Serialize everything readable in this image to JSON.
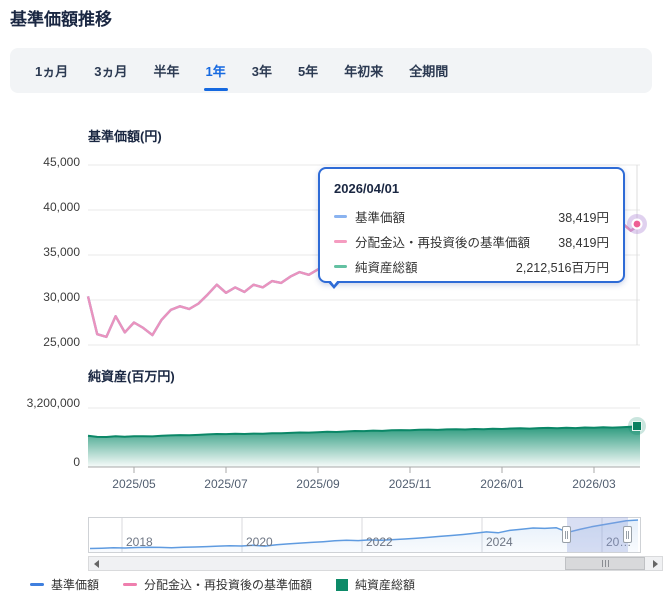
{
  "header": {
    "title": "基準価額推移"
  },
  "tabs": {
    "items": [
      {
        "label": "1ヵ月",
        "active": false
      },
      {
        "label": "3ヵ月",
        "active": false
      },
      {
        "label": "半年",
        "active": false
      },
      {
        "label": "1年",
        "active": true
      },
      {
        "label": "3年",
        "active": false
      },
      {
        "label": "5年",
        "active": false
      },
      {
        "label": "年初来",
        "active": false
      },
      {
        "label": "全期間",
        "active": false
      }
    ]
  },
  "tooltip": {
    "date": "2026/04/01",
    "rows": [
      {
        "label": "基準価額",
        "value": "38,419円",
        "color": "#8ab3f0"
      },
      {
        "label": "分配金込・再投資後の基準価額",
        "value": "38,419円",
        "color": "#f59cc0"
      },
      {
        "label": "純資産総額",
        "value": "2,212,516百万円",
        "color": "#63c1a2"
      }
    ]
  },
  "legend": {
    "items": [
      {
        "label": "基準価額",
        "color": "#3f7fde",
        "shape": "dash"
      },
      {
        "label": "分配金込・再投資後の基準価額",
        "color": "#ef7fae",
        "shape": "dash"
      },
      {
        "label": "純資産総額",
        "color": "#0d8a68",
        "shape": "square"
      }
    ]
  },
  "colors": {
    "accent_blue": "#1669e0",
    "price_line_pink": "#ea93bd",
    "price_line_blue": "#6d9eec",
    "asset_green": "#0b8767",
    "tooltip_border": "#2e6bd6",
    "navigator_line": "#5f9be0"
  },
  "chart_data": [
    {
      "type": "line",
      "title": "基準価額(円)",
      "ylim": [
        25000,
        45000
      ],
      "yticks": {
        "values": [
          45000,
          40000,
          35000,
          30000,
          25000
        ],
        "labels": [
          "45,000",
          "40,000",
          "35,000",
          "30,000",
          "25,000"
        ]
      },
      "x_range": [
        "2025/04/01",
        "2026/04/01"
      ],
      "grid": true,
      "legend_position": "bottom",
      "series": [
        {
          "name": "基準価額",
          "color": "#6d9eec",
          "values": [
            30400,
            26200,
            25900,
            28200,
            26400,
            27500,
            26900,
            26100,
            27800,
            28900,
            29300,
            29000,
            29600,
            30600,
            31700,
            30800,
            31400,
            30900,
            31700,
            31400,
            32100,
            31900,
            32600,
            33100,
            32800,
            33400,
            34000,
            33600,
            34400,
            35100,
            34800,
            35400,
            35100,
            35800,
            36100,
            35700,
            36300,
            36600,
            36200,
            36800,
            37000,
            36600,
            37200,
            36900,
            37400,
            37100,
            37700,
            38000,
            37500,
            38100,
            38300,
            37800,
            38400,
            38000,
            38600,
            38200,
            38700,
            38300,
            38600,
            37700,
            38419
          ]
        },
        {
          "name": "分配金込・再投資後の基準価額",
          "color": "#ea93bd",
          "values": [
            30400,
            26200,
            25900,
            28200,
            26400,
            27500,
            26900,
            26100,
            27800,
            28900,
            29300,
            29000,
            29600,
            30600,
            31700,
            30800,
            31400,
            30900,
            31700,
            31400,
            32100,
            31900,
            32600,
            33100,
            32800,
            33400,
            34000,
            33600,
            34400,
            35100,
            34800,
            35400,
            35100,
            35800,
            36100,
            35700,
            36300,
            36600,
            36200,
            36800,
            37000,
            36600,
            37200,
            36900,
            37400,
            37100,
            37700,
            38000,
            37500,
            38100,
            38300,
            37800,
            38400,
            38000,
            38600,
            38200,
            38700,
            38300,
            38600,
            37700,
            38419
          ]
        }
      ],
      "last_point": {
        "date": "2026/04/01",
        "value": 38419
      }
    },
    {
      "type": "area",
      "title": "純資産(百万円)",
      "ylim": [
        0,
        3200000
      ],
      "yticks": {
        "values": [
          3200000,
          0
        ],
        "labels": [
          "3,200,000",
          "0"
        ]
      },
      "xticks": {
        "labels": [
          "2025/05",
          "2025/07",
          "2025/09",
          "2025/11",
          "2026/01",
          "2026/03"
        ]
      },
      "grid": true,
      "series": [
        {
          "name": "純資産総額",
          "color": "#0b8767",
          "values": [
            1690000,
            1630000,
            1625000,
            1665000,
            1645000,
            1672000,
            1668000,
            1662000,
            1690000,
            1712000,
            1730000,
            1726000,
            1742000,
            1768000,
            1790000,
            1782000,
            1800000,
            1792000,
            1812000,
            1808000,
            1832000,
            1828000,
            1850000,
            1872000,
            1865000,
            1888000,
            1910000,
            1898000,
            1925000,
            1952000,
            1945000,
            1972000,
            1960000,
            1988000,
            2002000,
            1990000,
            2015000,
            2028000,
            2012000,
            2040000,
            2052000,
            2036000,
            2062000,
            2050000,
            2075000,
            2062000,
            2088000,
            2100000,
            2082000,
            2108000,
            2118000,
            2098000,
            2125000,
            2112000,
            2142000,
            2128000,
            2155000,
            2138000,
            2160000,
            2185000,
            2212516
          ]
        }
      ],
      "last_point": {
        "date": "2026/04/01",
        "value": 2212516
      }
    },
    {
      "type": "line",
      "title": "navigator",
      "x_range": [
        "2017",
        "2026/04"
      ],
      "xticks": {
        "labels": [
          "2018",
          "2020",
          "2022",
          "2024",
          "20…"
        ]
      },
      "selected_range": [
        "2025/04",
        "2026/04"
      ],
      "series": [
        {
          "name": "基準価額(全期間)",
          "color": "#5f9be0",
          "values": [
            10500,
            10800,
            11200,
            11000,
            11500,
            11800,
            11600,
            11300,
            11700,
            12000,
            12400,
            12800,
            13200,
            12900,
            13600,
            12800,
            14200,
            15000,
            15800,
            16500,
            17200,
            18000,
            18600,
            18200,
            18900,
            18500,
            19200,
            19800,
            20600,
            21400,
            22300,
            23200,
            24200,
            25400,
            26800,
            25900,
            28200,
            29400,
            30600,
            30200,
            30800,
            26400,
            29200,
            31800,
            33800,
            35800,
            37600,
            38419
          ]
        }
      ]
    }
  ]
}
